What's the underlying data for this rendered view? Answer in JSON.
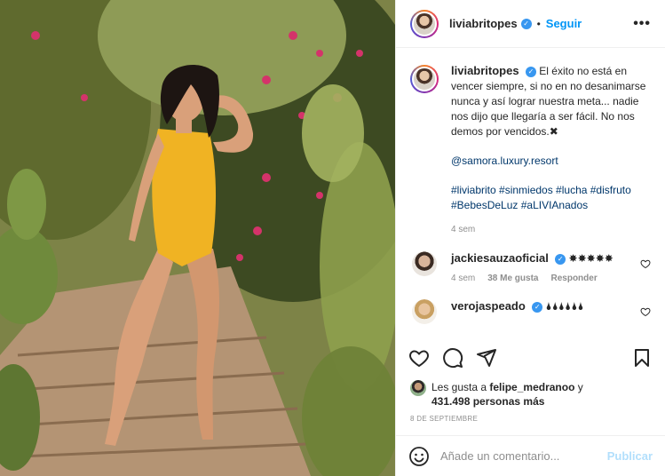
{
  "post": {
    "author": "liviabritopes",
    "follow_label": "Seguir",
    "more_label": "•••",
    "separator": "•"
  },
  "caption": {
    "username": "liviabritopes",
    "text": "El éxito no está en vencer siempre, si no en no desanimarse nunca y así lograr nuestra meta... nadie nos dijo que llegaría a ser fácil. No nos demos por vencidos.✖",
    "mention": "@samora.luxury.resort",
    "hashtags_line1": "#liviabrito #sinmiedos #lucha #disfruto",
    "hashtags_line2": "#BebesDeLuz #aLIVIAnados",
    "time": "4 sem"
  },
  "comments": [
    {
      "username": "jackiesauzaoficial",
      "text": "✸✸✸✸✸",
      "time": "4 sem",
      "likes": "38 Me gusta",
      "reply": "Responder"
    },
    {
      "username": "verojaspeado",
      "text": "🌢🌢🌢🌢🌢🌢"
    }
  ],
  "likes": {
    "prefix": "Les gusta a",
    "user": "felipe_medranoo",
    "connector": "y",
    "count": "431.498 personas más"
  },
  "date": "8 DE SEPTIEMBRE",
  "add_comment": {
    "placeholder": "Añade un comentario...",
    "publish_label": "Publicar"
  },
  "icons": {
    "verified": "verified-badge-icon",
    "like": "heart-icon",
    "comment": "comment-icon",
    "share": "paper-plane-icon",
    "save": "bookmark-icon",
    "emoji": "emoji-icon"
  },
  "colors": {
    "accent": "#0095f6",
    "verified": "#3897f0",
    "muted": "#8e8e8e",
    "publish_disabled": "#b2dffc",
    "swimsuit": "#f0b323"
  }
}
